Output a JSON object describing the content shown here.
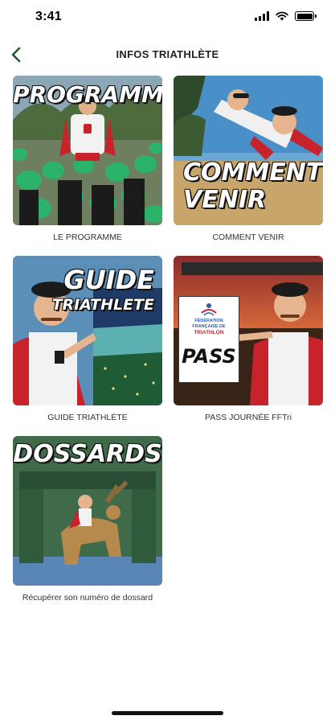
{
  "status_bar": {
    "time": "3:41"
  },
  "nav": {
    "title": "INFOS TRIATHLÈTE"
  },
  "tiles": [
    {
      "title_line1": "PROGRAMME",
      "title_line2": "",
      "caption": "LE PROGRAMME"
    },
    {
      "title_line1": "COMMENT",
      "title_line2": "VENIR",
      "caption": "COMMENT VENIR"
    },
    {
      "title_line1": "GUIDE",
      "title_line2": "TRIATHLETE",
      "caption": "GUIDE TRIATHLÈTE"
    },
    {
      "title_line1": "PASS",
      "title_line2": "",
      "caption": "PASS JOURNÉE FFTri"
    },
    {
      "title_line1": "DOSSARDS",
      "title_line2": "",
      "caption": "Récupérer son numéro de dossard"
    }
  ],
  "pass_sign": {
    "org_line1": "FÉDÉRATION",
    "org_line2": "FRANÇAISE DE",
    "org_line3": "TRIATHLON"
  },
  "colors": {
    "accent": "#1e5b2c",
    "cap_green": "#2bb36a",
    "cape_red": "#c8232b",
    "sky_blue": "#4a90c8"
  },
  "icons": {
    "back": "chevron-left-icon",
    "wifi": "wifi-icon",
    "battery": "battery-icon",
    "signal": "signal-icon"
  }
}
